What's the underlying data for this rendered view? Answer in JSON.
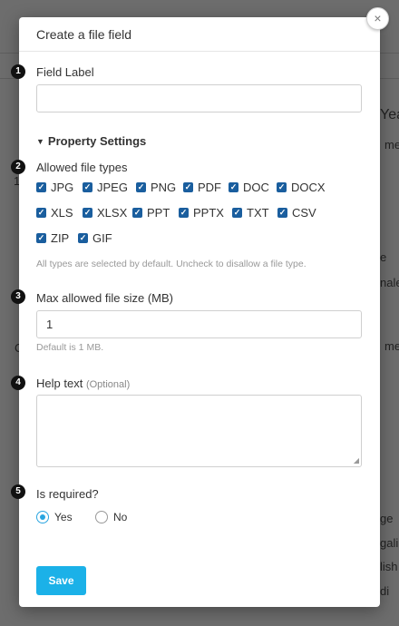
{
  "background": {
    "fragments": [
      "Yea",
      "me",
      "1",
      "e",
      "nale",
      "C",
      "me",
      "ge",
      "gali",
      "lish",
      "di"
    ]
  },
  "modal": {
    "title": "Create a file field",
    "close_symbol": "×",
    "steps": [
      "1",
      "2",
      "3",
      "4",
      "5"
    ],
    "field_label": {
      "label": "Field Label",
      "value": ""
    },
    "property_settings": {
      "label": "Property Settings",
      "caret_icon": "chevron-down-icon"
    },
    "allowed_file_types": {
      "label": "Allowed file types",
      "types": [
        {
          "name": "JPG",
          "checked": true
        },
        {
          "name": "JPEG",
          "checked": true
        },
        {
          "name": "PNG",
          "checked": true
        },
        {
          "name": "PDF",
          "checked": true
        },
        {
          "name": "DOC",
          "checked": true
        },
        {
          "name": "DOCX",
          "checked": true
        },
        {
          "name": "XLS",
          "checked": true
        },
        {
          "name": "XLSX",
          "checked": true
        },
        {
          "name": "PPT",
          "checked": true
        },
        {
          "name": "PPTX",
          "checked": true
        },
        {
          "name": "TXT",
          "checked": true
        },
        {
          "name": "CSV",
          "checked": true
        },
        {
          "name": "ZIP",
          "checked": true
        },
        {
          "name": "GIF",
          "checked": true
        }
      ],
      "hint": "All types are selected by default. Uncheck to disallow a file type."
    },
    "max_file_size": {
      "label": "Max allowed file size (MB)",
      "value": "1",
      "hint": "Default is 1 MB."
    },
    "help_text": {
      "label": "Help text",
      "optional": "(Optional)",
      "value": ""
    },
    "is_required": {
      "label": "Is required?",
      "options": [
        {
          "label": "Yes",
          "selected": true
        },
        {
          "label": "No",
          "selected": false
        }
      ]
    },
    "save_label": "Save"
  },
  "colors": {
    "accent": "#1bb1e8",
    "checkbox": "#1a5e9e",
    "overlay": "#6d6d6d"
  }
}
